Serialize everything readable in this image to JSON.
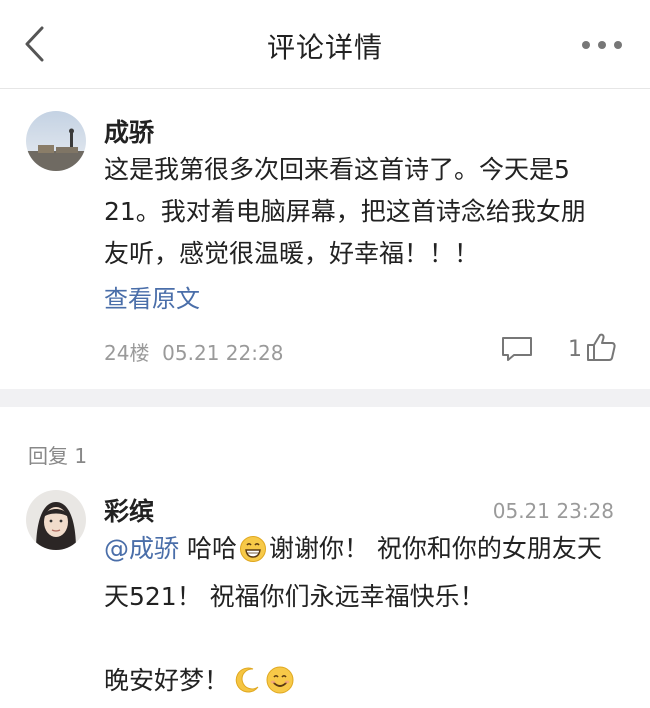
{
  "nav": {
    "title": "评论详情",
    "back_icon": "chevron-left-icon",
    "more_icon": "ellipsis-icon"
  },
  "comment": {
    "username": "成骄",
    "lines": [
      "这是我第很多次回来看这首诗了。今天是5",
      "21。我对着电脑屏幕，把这首诗念给我女朋",
      "友听，感觉很温暖，好幸福！！！"
    ],
    "view_original": "查看原文",
    "meta": "24楼  05.21 22:28",
    "like_count": "1"
  },
  "replies_section": {
    "label": "回复 1"
  },
  "reply": {
    "username": "彩缤",
    "time": "05.21 23:28",
    "mention": "@成骄",
    "line1_after_mention": " 哈哈",
    "line1_after_emoji": "谢谢你！ 祝你和你的女朋友天",
    "line2": "天521！ 祝福你们永远幸福快乐！",
    "line3": "晚安好梦！"
  },
  "colors": {
    "link": "#4a6ea9",
    "muted": "#9a9a9a",
    "divider": "#f1f1f3"
  }
}
